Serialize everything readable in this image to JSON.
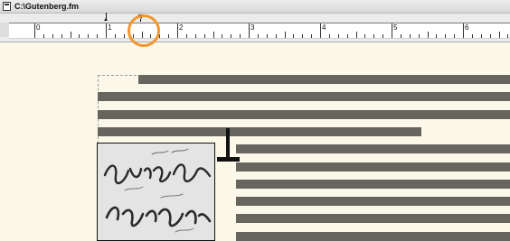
{
  "window": {
    "title": "C:\\Gutenberg.fm",
    "icon": "document-icon"
  },
  "ruler": {
    "numbers": [
      "0",
      "1",
      "2",
      "3",
      "4",
      "5",
      "6"
    ]
  },
  "markers": {
    "indent": "indent-marker-icon",
    "tab": "tab-stop-icon",
    "highlight_color": "#f2962e"
  },
  "text_lines_color": "#66665e",
  "image": {
    "description_icon": "calligraphy-image"
  }
}
